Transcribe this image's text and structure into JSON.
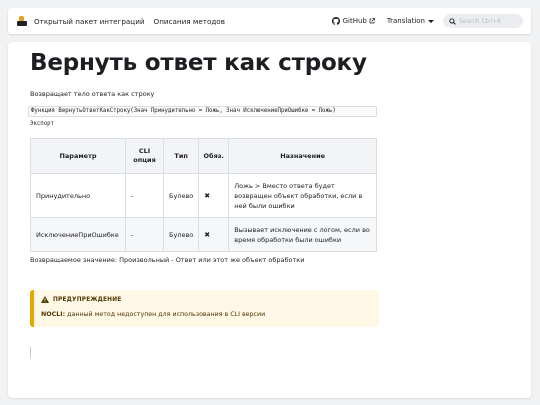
{
  "navbar": {
    "links": [
      "Открытый пакет интеграций",
      "Описания методов"
    ],
    "github_label": "GitHub",
    "translation_label": "Translation",
    "search_placeholder": "Search Ctrl+K"
  },
  "page": {
    "title": "Вернуть ответ как строку",
    "description": "Возвращает тело ответа как строку",
    "signature": "Функция ВернутьОтветКакСтроку(Знач Принудительно = Ложь, Знач ИсключениеПриОшибке = Ложь)",
    "export_label": "Экспорт"
  },
  "table": {
    "headers": [
      "Параметр",
      "CLI опция",
      "Тип",
      "Обяз.",
      "Назначение"
    ],
    "rows": [
      {
        "param": "Принудительно",
        "cli": "-",
        "type": "Булево",
        "required": "✖",
        "purpose": "Ложь > Вместо ответа будет возвращен объект обработки, если в ней были ошибки"
      },
      {
        "param": "ИсключениеПриОшибке",
        "cli": "-",
        "type": "Булево",
        "required": "✖",
        "purpose": "Вызывает исключение с логом, если во время обработки были ошибки"
      }
    ]
  },
  "return_value": "Возвращаемое значение: Произвольный - Ответ или этот же объект обработки",
  "warning": {
    "title": "ПРЕДУПРЕЖДЕНИЕ",
    "label": "NOCLI:",
    "text": " данный метод недоступен для использования в CLI версии"
  },
  "colors": {
    "warning_accent": "#e6a700",
    "warning_bg": "#fff8e6"
  }
}
